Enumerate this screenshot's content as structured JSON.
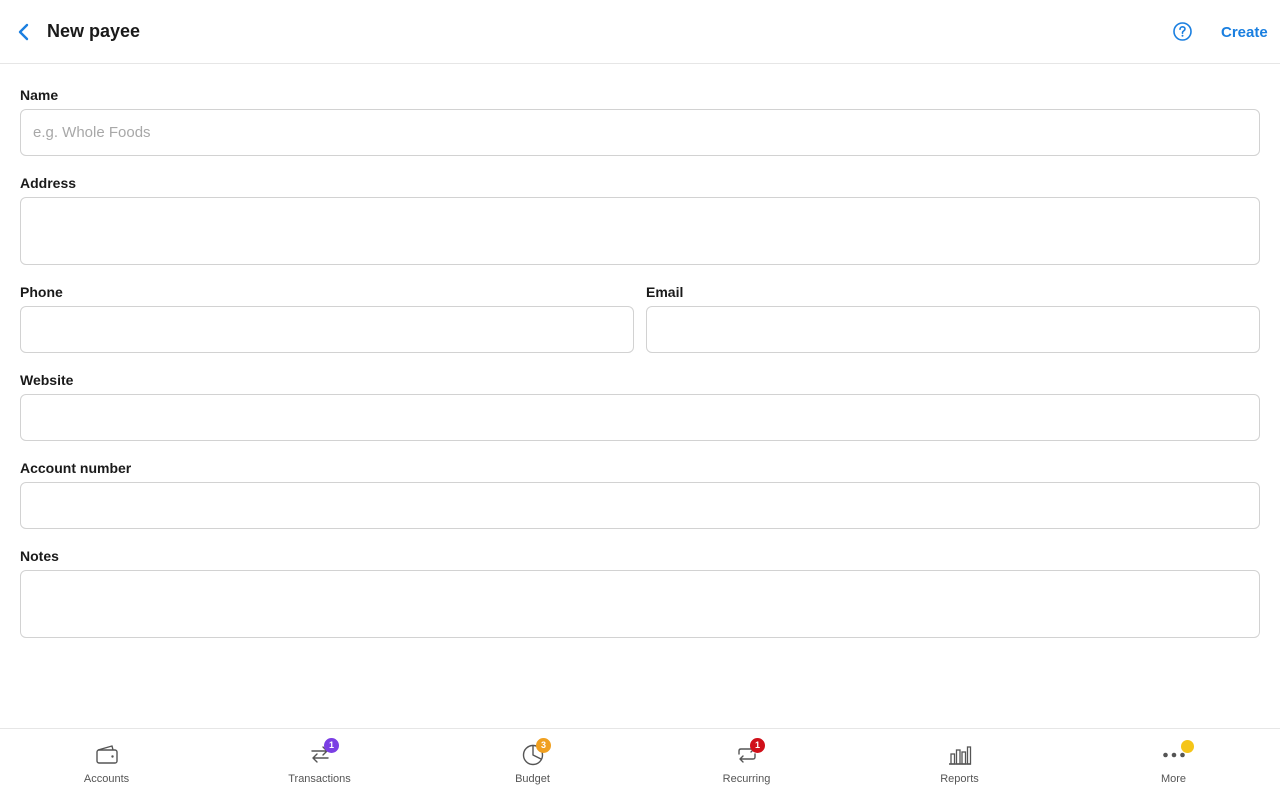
{
  "header": {
    "title": "New payee",
    "create_label": "Create"
  },
  "form": {
    "name": {
      "label": "Name",
      "placeholder": "e.g. Whole Foods",
      "value": ""
    },
    "address": {
      "label": "Address",
      "value": ""
    },
    "phone": {
      "label": "Phone",
      "value": ""
    },
    "email": {
      "label": "Email",
      "value": ""
    },
    "website": {
      "label": "Website",
      "value": ""
    },
    "account_number": {
      "label": "Account number",
      "value": ""
    },
    "notes": {
      "label": "Notes",
      "value": ""
    }
  },
  "nav": {
    "items": [
      {
        "label": "Accounts",
        "icon": "wallet-icon"
      },
      {
        "label": "Transactions",
        "icon": "arrows-swap-icon",
        "badge": "1",
        "badge_color": "#7b3fe4"
      },
      {
        "label": "Budget",
        "icon": "pie-chart-icon",
        "badge": "3",
        "badge_color": "#f0a020"
      },
      {
        "label": "Recurring",
        "icon": "repeat-icon",
        "badge": "1",
        "badge_color": "#d0101a"
      },
      {
        "label": "Reports",
        "icon": "bar-chart-icon"
      },
      {
        "label": "More",
        "icon": "more-dots-icon",
        "badge_color": "#f5c518"
      }
    ]
  },
  "colors": {
    "accent": "#1a7fe0",
    "border": "#d2d2d2"
  }
}
